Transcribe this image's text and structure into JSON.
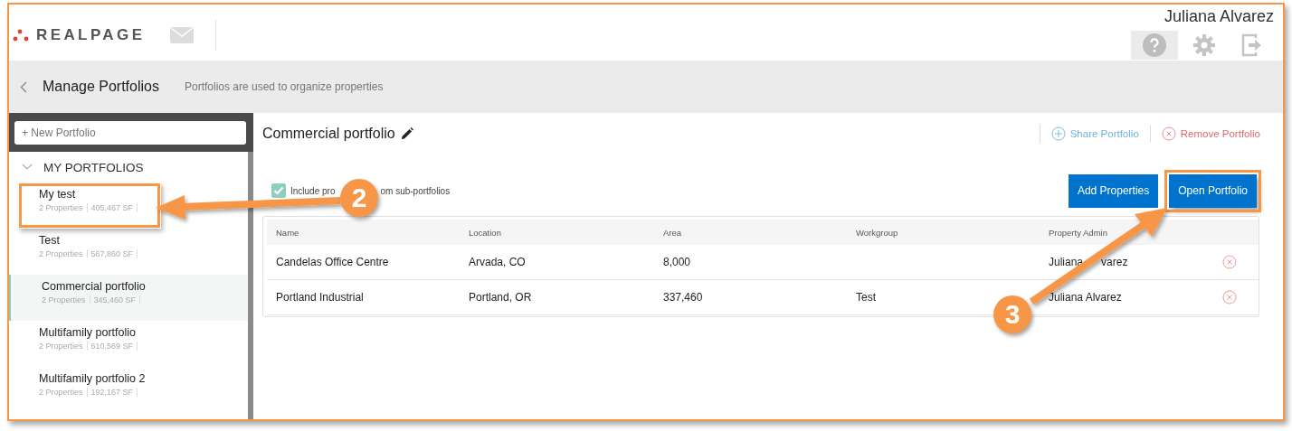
{
  "header": {
    "logo": "REALPAGE",
    "user_name": "Juliana Alvarez"
  },
  "page_bar": {
    "title": "Manage Portfolios",
    "subtitle": "Portfolios are used to organize properties"
  },
  "sidebar": {
    "new_portfolio": {
      "placeholder": "+ New Portfolio"
    },
    "section": {
      "label": "MY PORTFOLIOS",
      "expanded": true
    },
    "items": [
      {
        "name": "My test",
        "properties": "2 Properties",
        "area": "405,467 SF",
        "selected": false,
        "highlighted": true
      },
      {
        "name": "Test",
        "properties": "2 Properties",
        "area": "567,860 SF",
        "selected": false,
        "highlighted": false
      },
      {
        "name": "Commercial portfolio",
        "properties": "2 Properties",
        "area": "345,460 SF",
        "selected": true,
        "highlighted": false
      },
      {
        "name": "Multifamily portfolio",
        "properties": "2 Properties",
        "area": "610,569 SF",
        "selected": false,
        "highlighted": false
      },
      {
        "name": "Multifamily portfolio 2",
        "properties": "2 Properties",
        "area": "192,167 SF",
        "selected": false,
        "highlighted": false
      }
    ]
  },
  "main": {
    "title": "Commercial portfolio",
    "share": "Share Portfolio",
    "remove": "Remove Portfolio",
    "include_checkbox": {
      "label_parts": [
        "Include pro",
        "om sub-portfolios"
      ],
      "checked": true
    },
    "buttons": [
      {
        "label": "Add Properties",
        "highlighted": false
      },
      {
        "label": "Open Portfolio",
        "highlighted": true
      }
    ],
    "table": {
      "columns": [
        "Name",
        "Location",
        "Area",
        "Workgroup",
        "Property Admin"
      ],
      "rows": [
        {
          "cells": [
            "Candelas Office Centre",
            "Arvada, CO",
            "8,000",
            "",
            [
              "Juliana",
              "varez"
            ]
          ]
        },
        {
          "cells": [
            "Portland Industrial",
            "Portland, OR",
            "337,460",
            "Test",
            [
              "Juliana Alvarez"
            ]
          ]
        }
      ]
    }
  },
  "annotations": [
    {
      "number": "2"
    },
    {
      "number": "3"
    }
  ]
}
